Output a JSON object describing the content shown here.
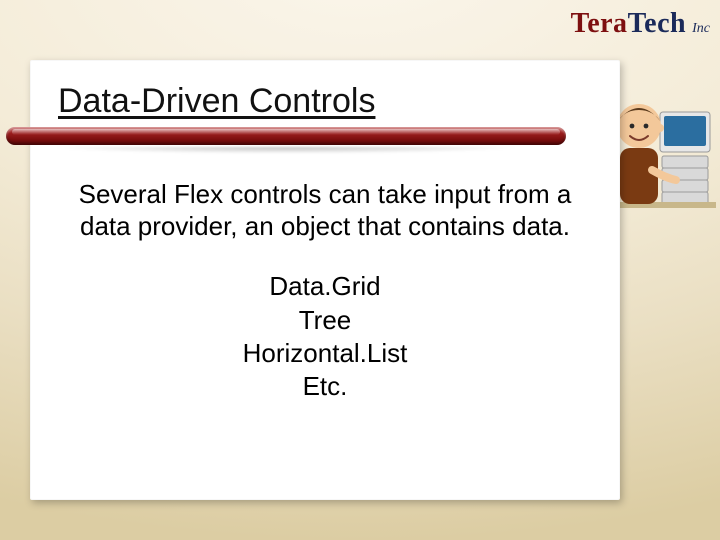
{
  "brand": {
    "tera": "Tera",
    "tech": "Tech",
    "inc": "Inc"
  },
  "slide": {
    "title": "Data-Driven Controls",
    "intro": "Several Flex controls can take input from a data provider, an object that contains data.",
    "items": {
      "0": "Data.Grid",
      "1": "Tree",
      "2": "Horizontal.List",
      "3": "Etc."
    }
  }
}
